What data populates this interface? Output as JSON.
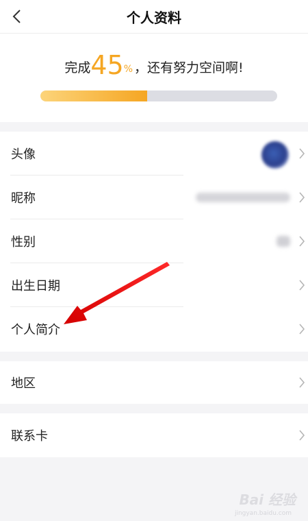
{
  "header": {
    "title": "个人资料"
  },
  "progress": {
    "prefix": "完成",
    "percent_value": "45",
    "percent_sign": "%",
    "suffix": "，还有努力空间啊!",
    "fill_fraction": 0.45,
    "accent_color": "#f5a623"
  },
  "sections": [
    {
      "items": [
        {
          "label": "头像",
          "value_type": "avatar"
        },
        {
          "label": "昵称",
          "value_type": "blurred-text"
        },
        {
          "label": "性别",
          "value_type": "blurred-small"
        },
        {
          "label": "出生日期",
          "value_type": "none"
        },
        {
          "label": "个人简介",
          "value_type": "none"
        }
      ]
    },
    {
      "items": [
        {
          "label": "地区",
          "value_type": "none"
        }
      ]
    },
    {
      "items": [
        {
          "label": "联系卡",
          "value_type": "none"
        }
      ]
    }
  ],
  "annotation": {
    "type": "red-arrow",
    "target": "个人简介"
  },
  "watermark": {
    "text": "Bai 经验",
    "sub": "jingyan.baidu.com"
  },
  "icons": {
    "back": "chevron-left-icon",
    "row_chevron": "chevron-right-icon"
  }
}
